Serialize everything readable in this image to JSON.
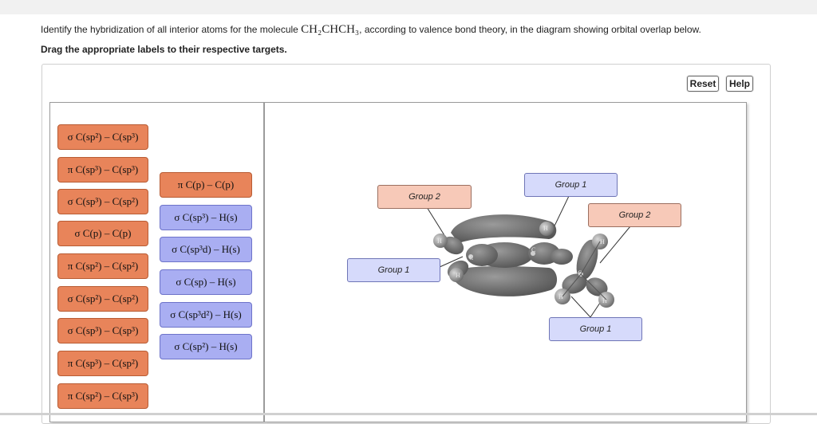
{
  "question": {
    "prefix": "Identify the hybridization of all interior atoms for the molecule ",
    "formula": "CH₂CHCH₃",
    "suffix": ", according to valence bond theory, in the diagram showing orbital overlap below."
  },
  "instruction": "Drag the appropriate labels to their respective targets.",
  "buttons": {
    "reset": "Reset",
    "help": "Help"
  },
  "labels": {
    "left": [
      "σ C(sp²) – C(sp³)",
      "π C(sp³) – C(sp³)",
      "σ C(sp³) – C(sp²)",
      "σ C(p) – C(p)",
      "π C(sp²) – C(sp²)",
      "σ C(sp²) – C(sp²)",
      "σ C(sp³) – C(sp³)",
      "π C(sp³) – C(sp²)",
      "π C(sp²) – C(sp³)"
    ],
    "right": [
      "π C(p) – C(p)",
      "σ C(sp³) – H(s)",
      "σ C(sp³d) – H(s)",
      "σ C(sp) – H(s)",
      "σ C(sp³d²) – H(s)",
      "σ C(sp²) – H(s)"
    ]
  },
  "targets": {
    "group2_left": "Group 2",
    "group1_top": "Group 1",
    "group2_right": "Group 2",
    "group1_left": "Group 1",
    "group1_bottom": "Group 1"
  },
  "atoms": {
    "c": "C",
    "h": "H"
  },
  "colors": {
    "orange_chip": "#e8845a",
    "blue_chip": "#a9aef2",
    "target_pink": "#f7c9b8",
    "target_lavender": "#d6dafb",
    "orbital": "#6e6e6e"
  }
}
